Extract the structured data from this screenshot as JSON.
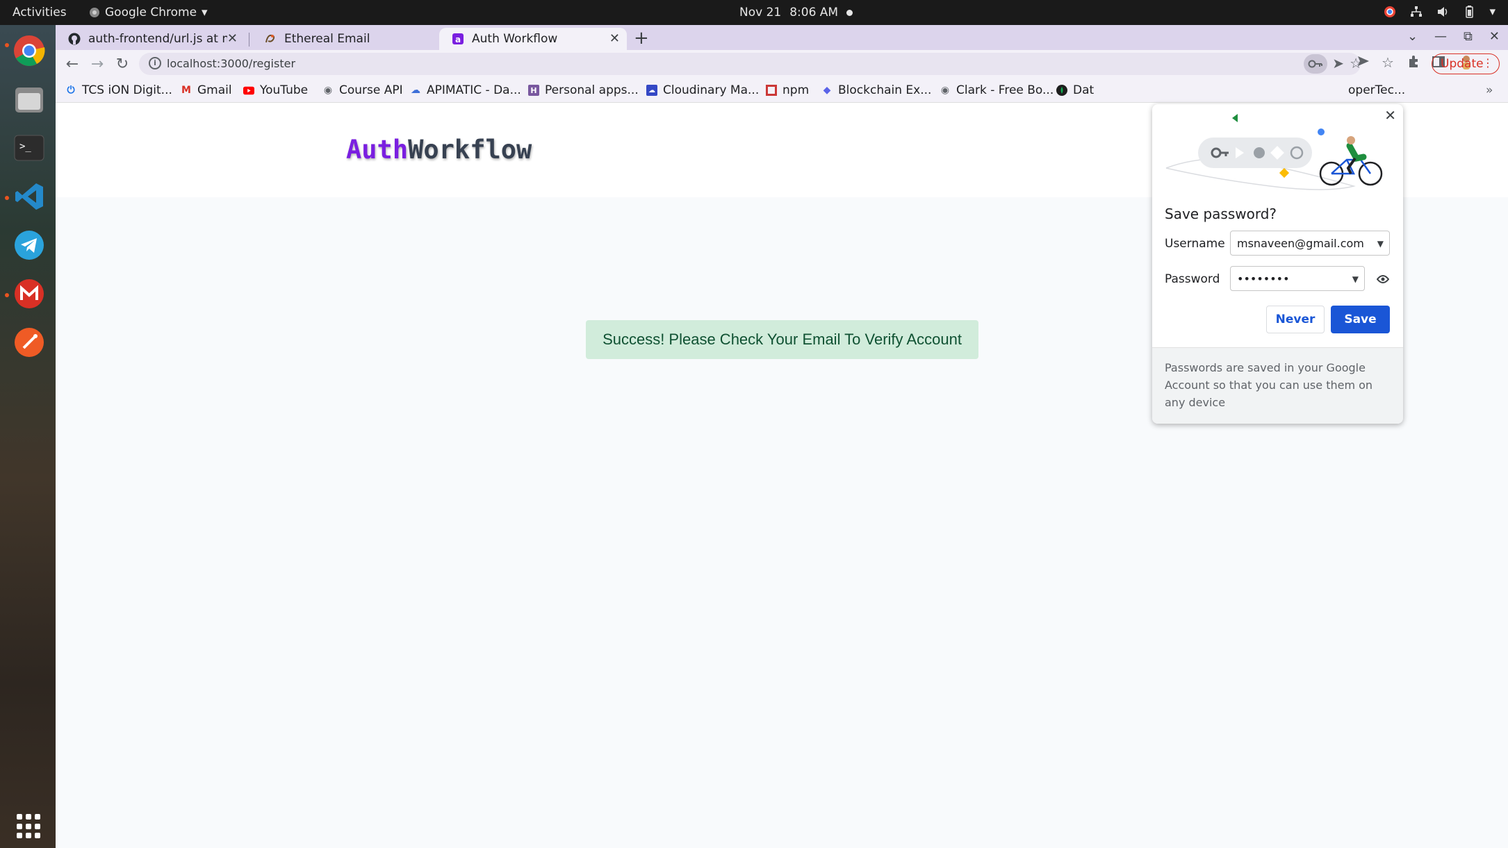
{
  "topbar": {
    "activities": "Activities",
    "app_name": "Google Chrome",
    "date": "Nov 21",
    "time": "8:06 AM"
  },
  "dock": {
    "apps": [
      "chrome-icon",
      "files-icon",
      "terminal-icon",
      "vscode-icon",
      "telegram-icon",
      "gmail-icon",
      "postman-icon"
    ]
  },
  "browser": {
    "tabs": [
      {
        "title": "auth-frontend/url.js at m",
        "icon": "github-icon"
      },
      {
        "title": "Ethereal Email",
        "icon": "ethereal-icon"
      },
      {
        "title": "Auth Workflow",
        "icon": "authworkflow-icon",
        "active": true
      }
    ],
    "url": "localhost:3000/register",
    "update_label": "Update",
    "bookmarks": [
      {
        "label": "TCS iON Digit...",
        "icon": "power-icon"
      },
      {
        "label": "Gmail",
        "icon": "gmail-icon"
      },
      {
        "label": "YouTube",
        "icon": "youtube-icon"
      },
      {
        "label": "Course API",
        "icon": "globe-icon"
      },
      {
        "label": "APIMATIC - Da...",
        "icon": "cloud-icon"
      },
      {
        "label": "Personal apps...",
        "icon": "heroku-icon"
      },
      {
        "label": "Cloudinary Ma...",
        "icon": "cloudinary-icon"
      },
      {
        "label": "npm",
        "icon": "npm-icon"
      },
      {
        "label": "Blockchain Ex...",
        "icon": "blockchain-icon"
      },
      {
        "label": "Clark - Free Bo...",
        "icon": "globe-icon"
      },
      {
        "label": "Dat",
        "icon": "mongodb-icon"
      },
      {
        "label": "operTec...",
        "icon": "none"
      }
    ]
  },
  "page": {
    "logo_part1": "Auth",
    "logo_part2": "Workflow",
    "alert_text": "Success! Please Check Your Email To Verify Account"
  },
  "popup": {
    "title": "Save password?",
    "username_label": "Username",
    "username_value": "msnaveen@gmail.com",
    "password_label": "Password",
    "password_value": "••••••••",
    "never_label": "Never",
    "save_label": "Save",
    "footer_text": "Passwords are saved in your Google Account so that you can use them on any device"
  },
  "colors": {
    "brand_purple": "#7a1fe0",
    "alert_bg": "#d1ecdb",
    "alert_text": "#0f5132",
    "chrome_blue": "#1a56d6",
    "update_red": "#d93025"
  }
}
